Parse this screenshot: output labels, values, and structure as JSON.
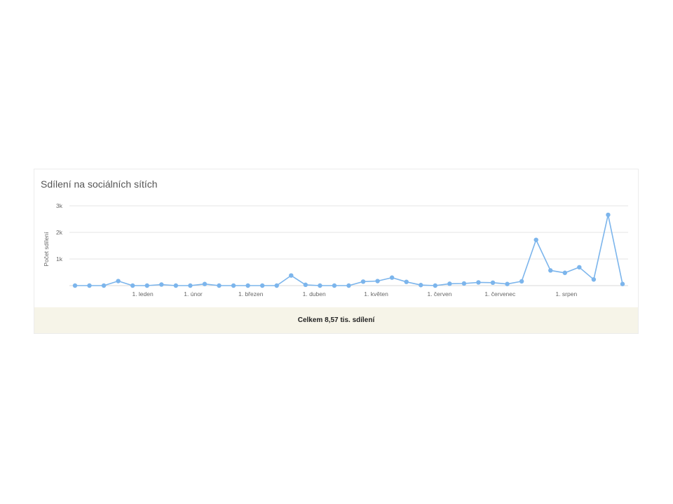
{
  "card": {
    "title": "Sdílení na sociálních sítích",
    "footer": "Celkem 8,57 tis. sdílení"
  },
  "chart_data": {
    "type": "line",
    "ylabel": "Počet sdílení",
    "ylim": [
      0,
      3000
    ],
    "y_ticks": [
      {
        "value": 1000,
        "label": "1k"
      },
      {
        "value": 2000,
        "label": "2k"
      },
      {
        "value": 3000,
        "label": "3k"
      }
    ],
    "x_ticks": [
      {
        "index": 4.7,
        "label": "1. leden"
      },
      {
        "index": 8.2,
        "label": "1. únor"
      },
      {
        "index": 12.2,
        "label": "1. březen"
      },
      {
        "index": 16.6,
        "label": "1. duben"
      },
      {
        "index": 20.9,
        "label": "1. květen"
      },
      {
        "index": 25.3,
        "label": "1. červen"
      },
      {
        "index": 29.5,
        "label": "1. červenec"
      },
      {
        "index": 34.1,
        "label": "1. srpen"
      }
    ],
    "grid": true,
    "line_color": "#7cb5ec",
    "series": [
      {
        "values": [
          0,
          0,
          0,
          170,
          0,
          0,
          40,
          0,
          0,
          60,
          0,
          0,
          0,
          0,
          0,
          380,
          30,
          0,
          0,
          0,
          150,
          170,
          300,
          140,
          20,
          0,
          70,
          80,
          120,
          110,
          60,
          160,
          1720,
          570,
          480,
          690,
          230,
          2660,
          60
        ]
      }
    ]
  }
}
